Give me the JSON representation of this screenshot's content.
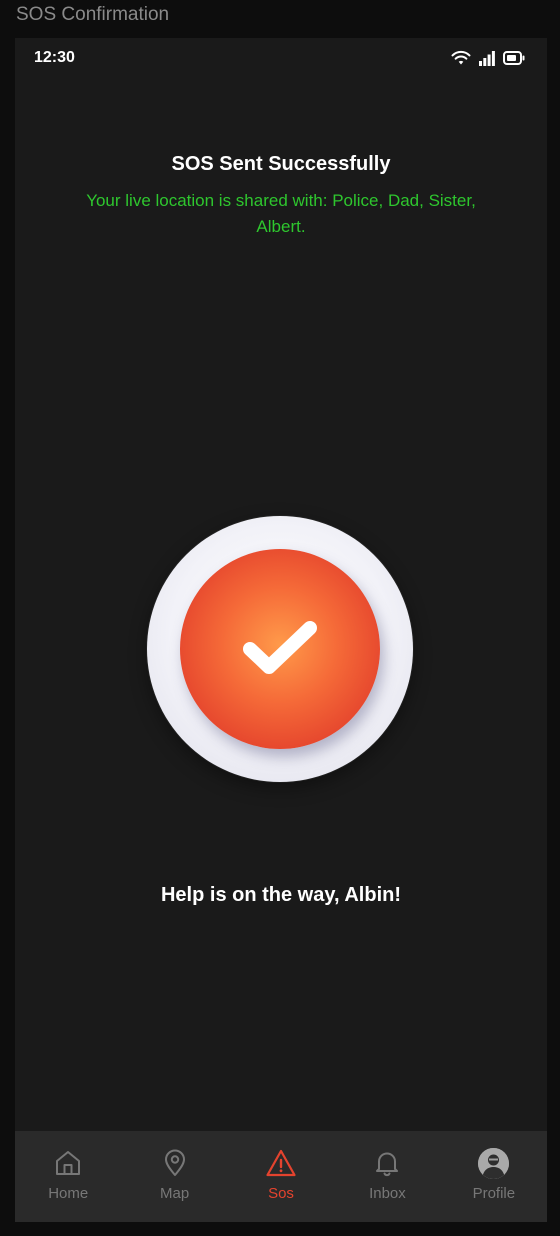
{
  "window": {
    "title": "SOS Confirmation"
  },
  "status_bar": {
    "time": "12:30"
  },
  "header": {
    "title": "SOS Sent Successfully",
    "subtitle": "Your live location is shared with: Police, Dad, Sister, Albert."
  },
  "message": "Help is on the way, Albin!",
  "colors": {
    "accent": "#e4432e",
    "success": "#2ec62e",
    "background": "#1a1a1a",
    "nav_background": "#2a2a2a"
  },
  "nav": {
    "items": [
      {
        "label": "Home",
        "icon": "home-icon"
      },
      {
        "label": "Map",
        "icon": "map-pin-icon"
      },
      {
        "label": "Sos",
        "icon": "warning-icon",
        "active": true
      },
      {
        "label": "Inbox",
        "icon": "bell-icon"
      },
      {
        "label": "Profile",
        "icon": "avatar"
      }
    ]
  }
}
